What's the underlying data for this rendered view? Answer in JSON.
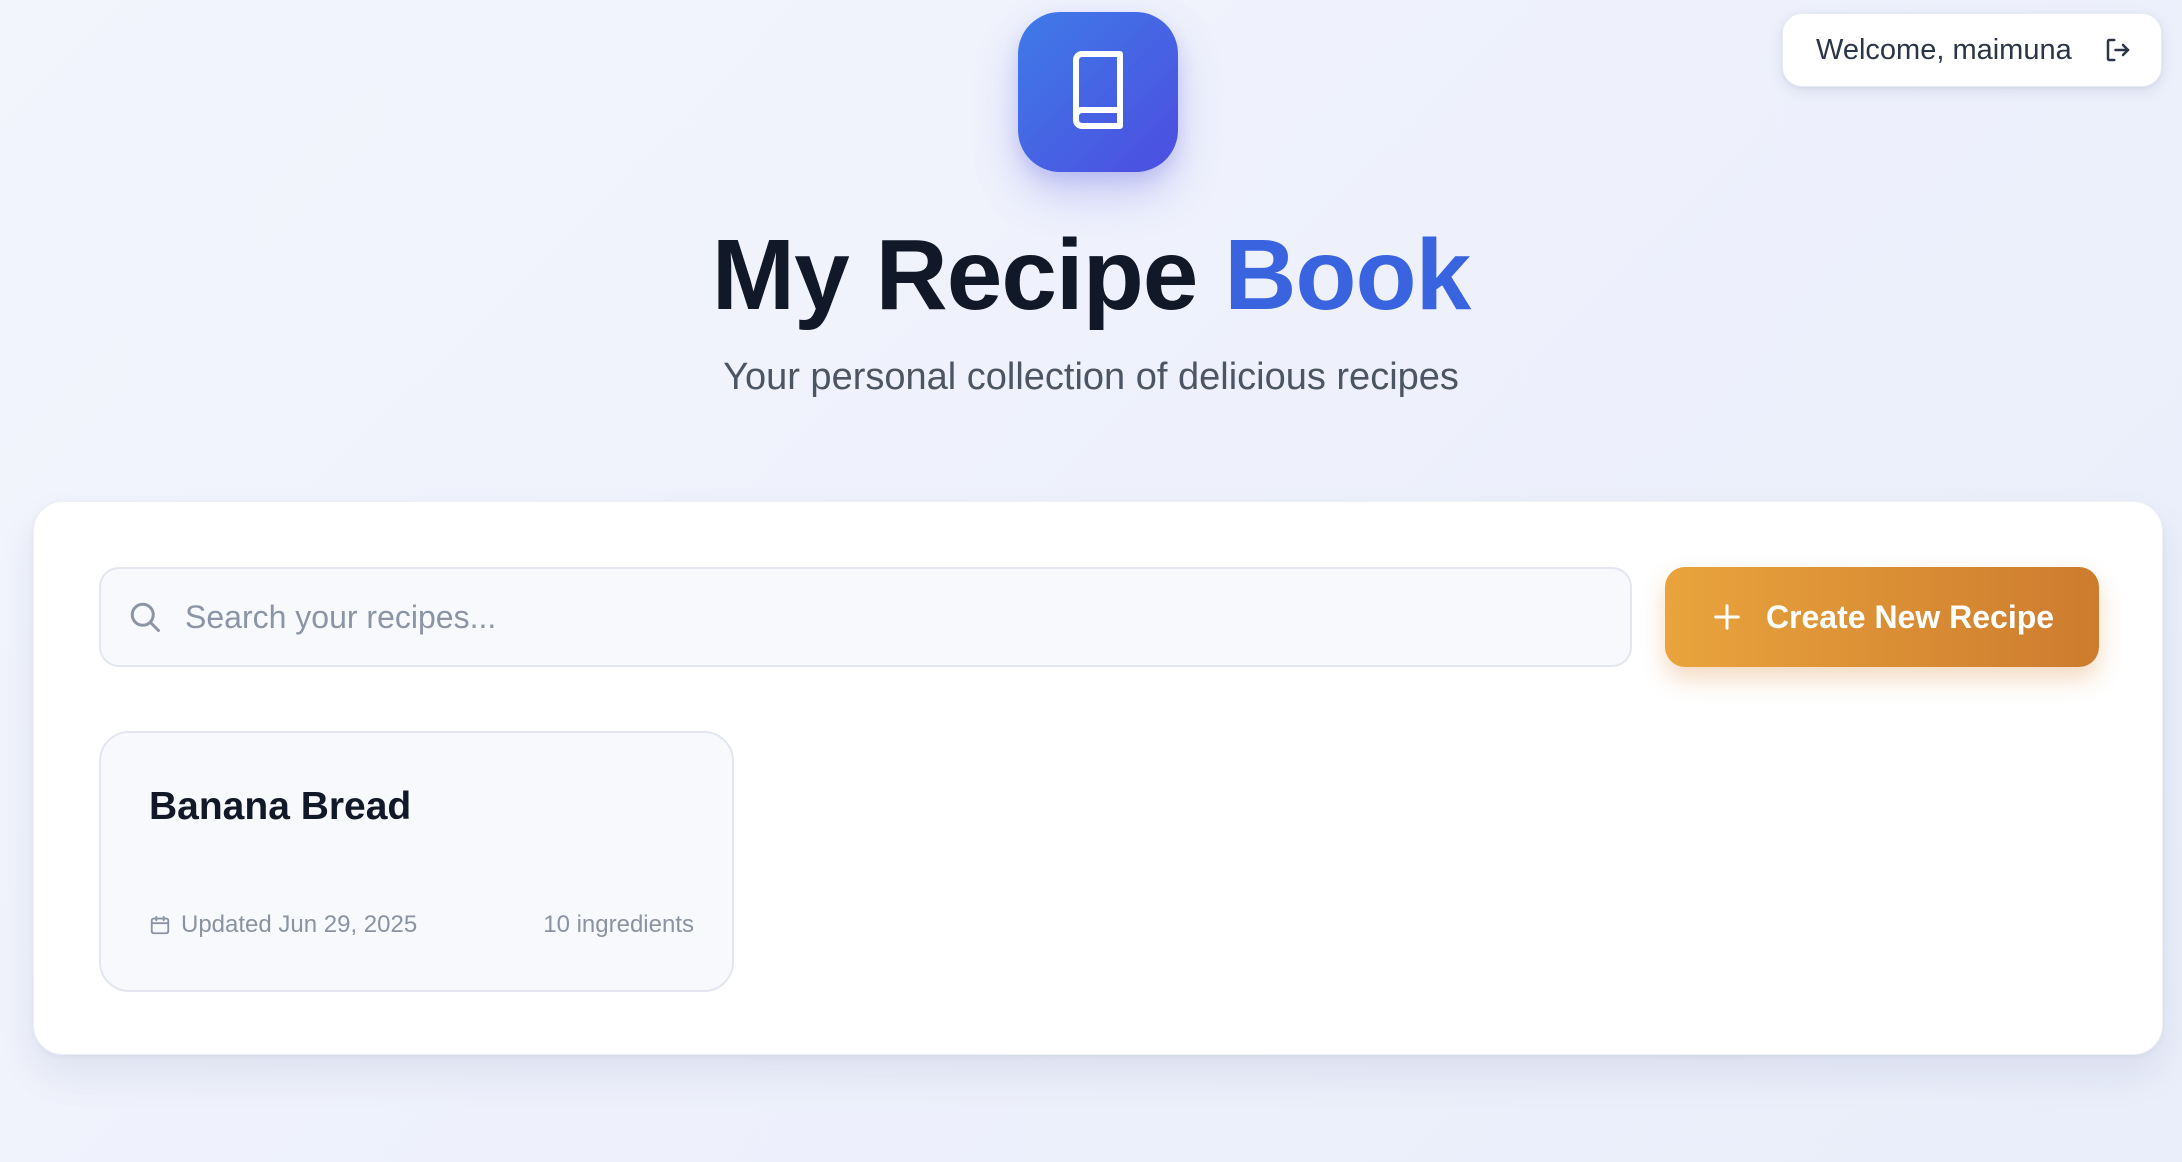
{
  "header": {
    "welcome_text": "Welcome, maimuna",
    "logout_icon": "logout-icon",
    "logo_icon": "book-icon",
    "title_main": "My Recipe ",
    "title_accent": "Book",
    "subtitle": "Your personal collection of delicious recipes"
  },
  "toolbar": {
    "search_placeholder": "Search your recipes...",
    "search_value": "",
    "search_icon": "search-icon",
    "create_label": "Create New Recipe",
    "create_icon": "plus-icon"
  },
  "recipes": [
    {
      "title": "Banana Bread",
      "updated": "Updated Jun 29, 2025",
      "ingredients": "10 ingredients",
      "date_icon": "calendar-icon"
    }
  ],
  "colors": {
    "accent": "#3a63e0",
    "logo_gradient_start": "#3f7be8",
    "logo_gradient_end": "#4d4de0",
    "button_gradient_start": "#e9a43c",
    "button_gradient_end": "#cd7b2e"
  }
}
